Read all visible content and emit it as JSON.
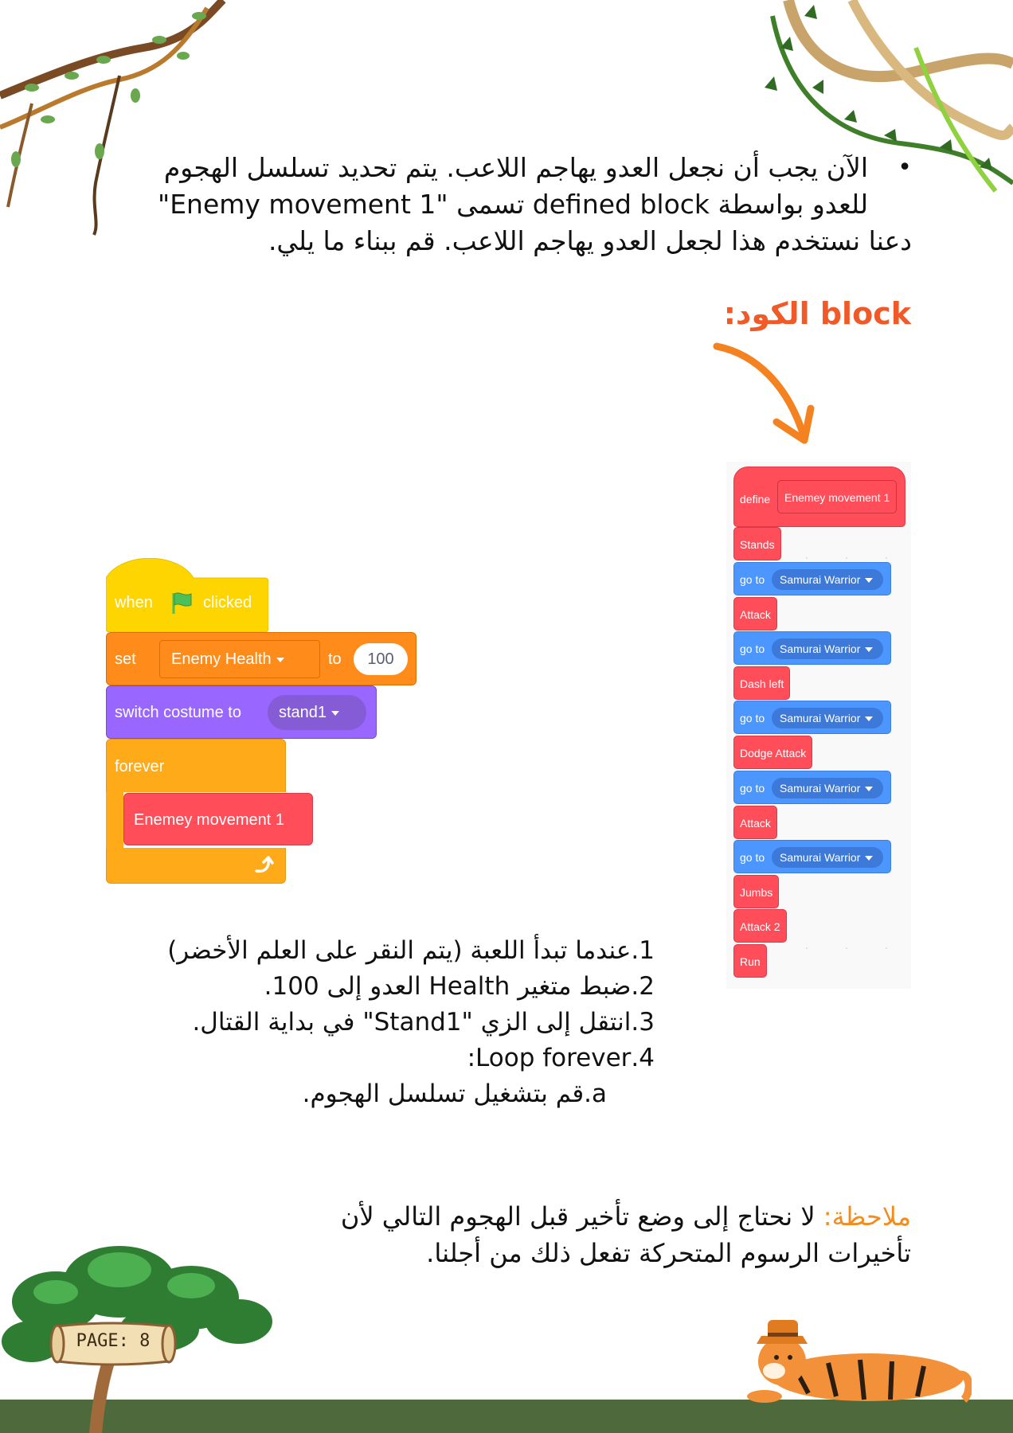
{
  "intro": {
    "bullet": "•",
    "line1": "الآن يجب أن نجعل العدو يهاجم اللاعب. يتم تحديد تسلسل الهجوم",
    "line2": "للعدو بواسطة defined block تسمى \"Enemy movement 1\"",
    "line3": "دعنا نستخدم هذا لجعل العدو يهاجم اللاعب. قم ببناء ما يلي."
  },
  "heading": "block الكود:",
  "main_script": {
    "when_label": "when",
    "clicked_label": "clicked",
    "set_label": "set",
    "variable_name": "Enemy Health",
    "to_label": "to",
    "set_value": "100",
    "switch_label": "switch costume to",
    "costume_name": "stand1",
    "forever_label": "forever",
    "call_block": "Enemey movement 1"
  },
  "define_script": {
    "define_label": "define",
    "define_name": "Enemey movement 1",
    "blocks": [
      {
        "type": "red",
        "text": "Stands"
      },
      {
        "type": "goto",
        "label": "go to",
        "target": "Samurai Warrior"
      },
      {
        "type": "red",
        "text": "Attack"
      },
      {
        "type": "goto",
        "label": "go to",
        "target": "Samurai Warrior"
      },
      {
        "type": "red",
        "text": "Dash left"
      },
      {
        "type": "goto",
        "label": "go to",
        "target": "Samurai Warrior"
      },
      {
        "type": "red",
        "text": "Dodge Attack"
      },
      {
        "type": "goto",
        "label": "go to",
        "target": "Samurai Warrior"
      },
      {
        "type": "red",
        "text": "Attack"
      },
      {
        "type": "goto",
        "label": "go to",
        "target": "Samurai Warrior"
      },
      {
        "type": "red",
        "text": "Jumbs"
      },
      {
        "type": "red",
        "text": "Attack 2"
      },
      {
        "type": "red",
        "text": "Run"
      }
    ]
  },
  "steps": {
    "s1": "1.عندما تبدأ اللعبة (يتم النقر على العلم الأخضر)",
    "s2": "2.ضبط متغير Health العدو إلى 100.",
    "s3": "3.انتقل إلى الزي \"Stand1\" في بداية القتال.",
    "s4": "4.Loop forever:",
    "s4a": "a.قم بتشغيل تسلسل الهجوم."
  },
  "note": {
    "label": "ملاحظة:",
    "line1": "لا نحتاج إلى وضع تأخير قبل الهجوم التالي لأن",
    "line2": "تأخيرات الرسوم المتحركة تفعل ذلك من أجلنا."
  },
  "page_label": "PAGE: 8",
  "colors": {
    "heading": "#f05a28",
    "note_label": "#f28c1e",
    "events": "#ffd500",
    "variables": "#ff8c1a",
    "looks": "#9966ff",
    "control": "#ffab19",
    "custom": "#ff4d5a",
    "motion": "#4c97ff",
    "ground": "#4e6a3c"
  }
}
